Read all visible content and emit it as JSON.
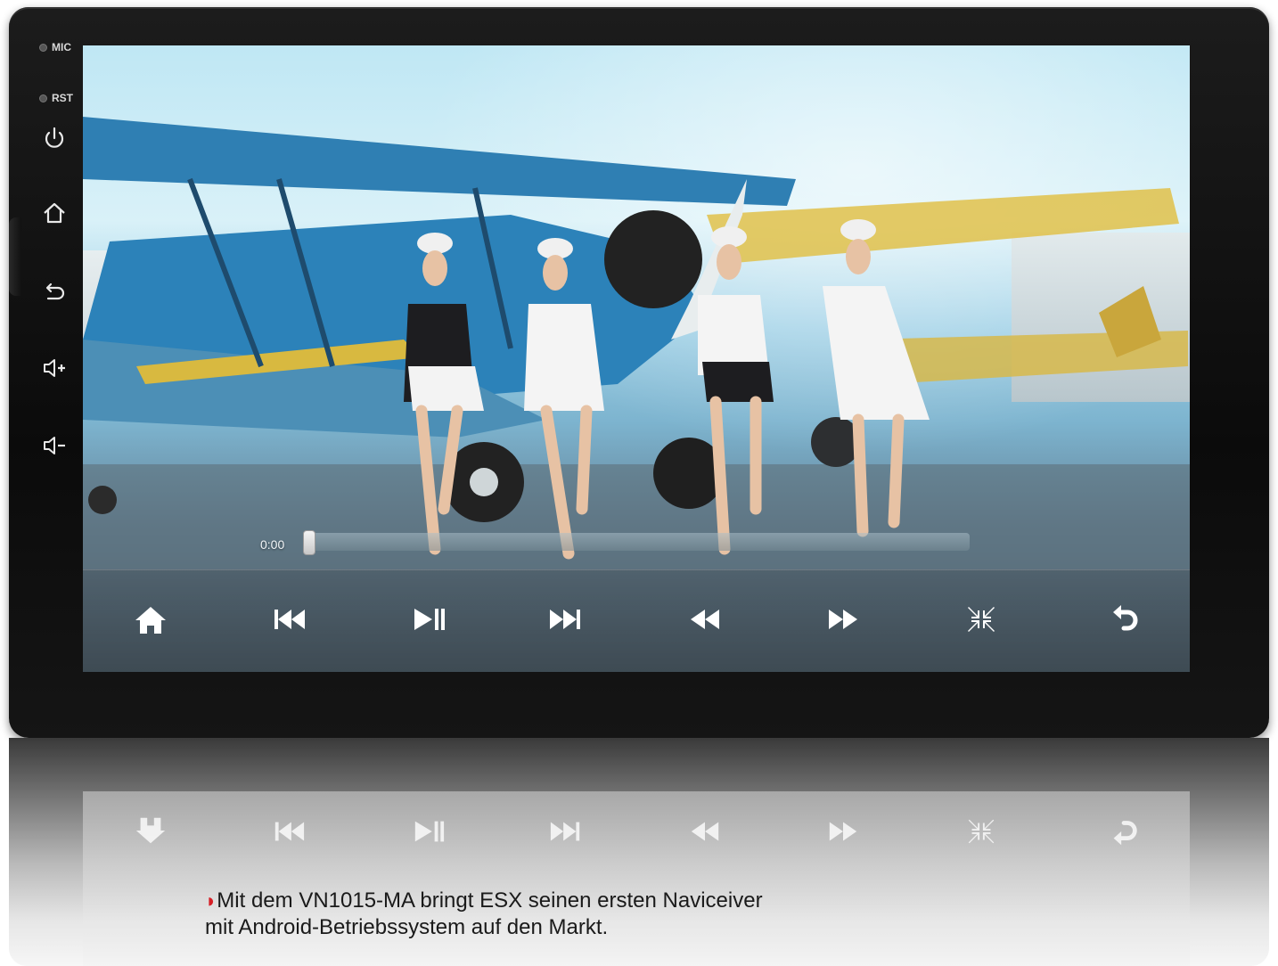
{
  "device": {
    "labels": {
      "mic": "MIC",
      "rst": "RST"
    },
    "side_buttons": [
      {
        "icon": "power-icon"
      },
      {
        "icon": "home-icon"
      },
      {
        "icon": "back-icon"
      },
      {
        "icon": "volume-up-icon"
      },
      {
        "icon": "volume-down-icon"
      }
    ]
  },
  "player": {
    "time": "0:00",
    "progress": 0.0,
    "controls": [
      {
        "icon": "home-icon"
      },
      {
        "icon": "previous-track-icon"
      },
      {
        "icon": "play-pause-icon"
      },
      {
        "icon": "next-track-icon"
      },
      {
        "icon": "rewind-icon"
      },
      {
        "icon": "fast-forward-icon"
      },
      {
        "icon": "exit-fullscreen-icon"
      },
      {
        "icon": "return-icon"
      }
    ]
  },
  "caption": {
    "line1": "Mit dem VN1015-MA bringt ESX seinen ersten Naviceiver",
    "line2": "mit Android-Betriebssystem auf den Markt."
  },
  "colors": {
    "caption_marker": "#d61f26",
    "icon": "#ffffff"
  }
}
